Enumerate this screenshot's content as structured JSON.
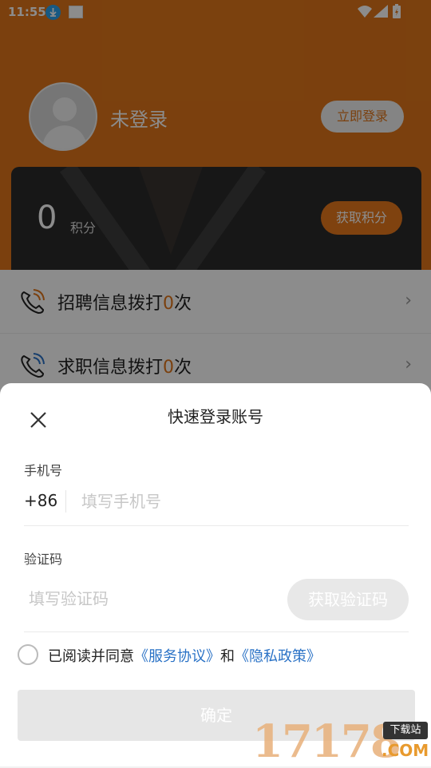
{
  "status_bar": {
    "time": "11:55"
  },
  "profile": {
    "username": "未登录",
    "login_button": "立即登录"
  },
  "points": {
    "value": "0",
    "label": "积分",
    "earn_button": "获取积分"
  },
  "menu": {
    "items": [
      {
        "prefix": "招聘信息拨打",
        "count": "0",
        "suffix": "次"
      },
      {
        "prefix": "求职信息拨打",
        "count": "0",
        "suffix": "次"
      }
    ]
  },
  "login_sheet": {
    "title": "快速登录账号",
    "phone_label": "手机号",
    "country_code": "+86",
    "phone_placeholder": "填写手机号",
    "phone_value": "",
    "code_label": "验证码",
    "code_placeholder": "填写验证码",
    "code_value": "",
    "get_code_button": "获取验证码",
    "agree_prefix": "已阅读并同意",
    "service_link": "《服务协议》",
    "agree_and": "和",
    "privacy_link": "《隐私政策》",
    "confirm_button": "确定"
  },
  "watermark": {
    "number": "17178",
    "tag": "下载站",
    "domain": ".COM"
  },
  "colors": {
    "accent": "#e0761a",
    "link": "#2a72c6",
    "disabled": "#e6e6e6"
  }
}
